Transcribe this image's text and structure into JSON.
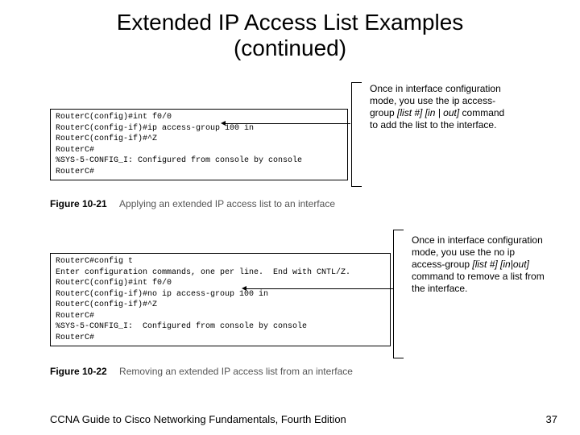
{
  "title_line1": "Extended IP Access List Examples",
  "title_line2": "(continued)",
  "block1": {
    "terminal": "RouterC(config)#int f0/0\nRouterC(config-if)#ip access-group 100 in\nRouterC(config-if)#^Z\nRouterC#\n%SYS-5-CONFIG_I: Configured from console by console\nRouterC#",
    "note_pre": "Once in interface configuration mode, you use the ip access-group ",
    "note_italic": "[list #] [in | out]",
    "note_post": " command to add the list to the interface.",
    "fig_num": "Figure 10-21",
    "fig_cap": "Applying an extended IP access list to an interface"
  },
  "block2": {
    "terminal": "RouterC#config t\nEnter configuration commands, one per line.  End with CNTL/Z.\nRouterC(config)#int f0/0\nRouterC(config-if)#no ip access-group 100 in\nRouterC(config-if)#^Z\nRouterC#\n%SYS-5-CONFIG_I:  Configured from console by console\nRouterC#",
    "note_pre": "Once in interface configuration mode, you use the no ip access-group ",
    "note_italic": "[list #] [in|out]",
    "note_post": " command to remove a list from the interface.",
    "fig_num": "Figure 10-22",
    "fig_cap": "Removing an extended IP access list from an interface"
  },
  "footer": "CCNA Guide to Cisco Networking Fundamentals, Fourth Edition",
  "pagenum": "37"
}
